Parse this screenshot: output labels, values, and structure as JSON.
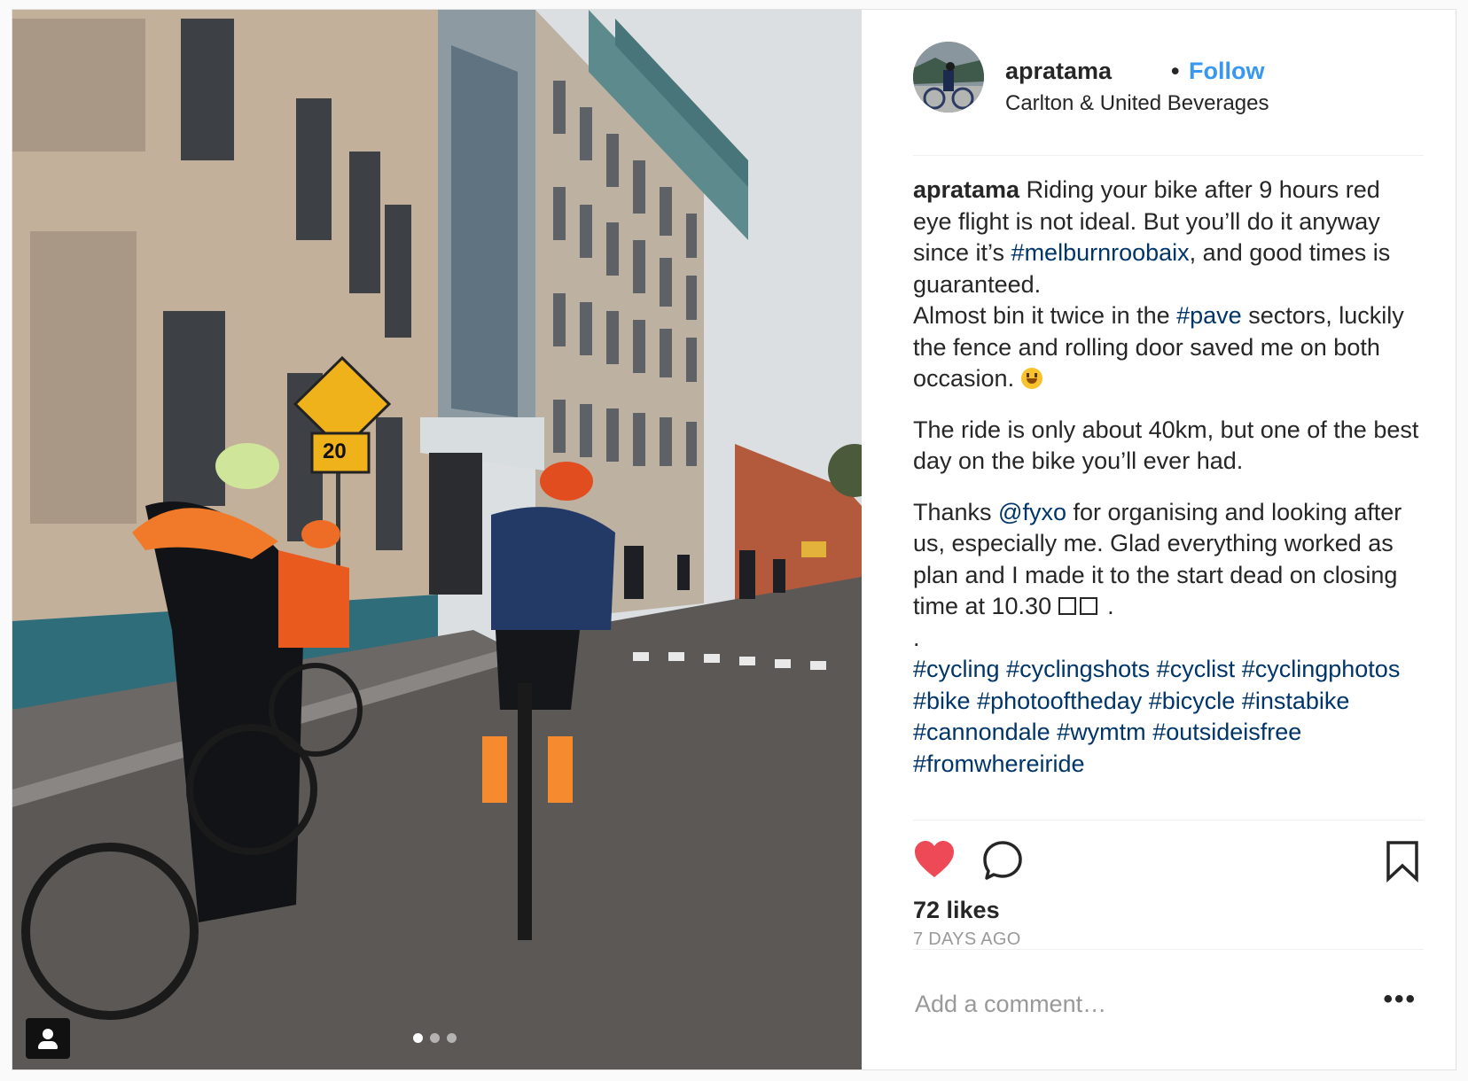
{
  "post": {
    "carousel_dot_count": 3,
    "active_dot": 0
  },
  "header": {
    "username": "apratama",
    "separator": "•",
    "follow_label": "Follow",
    "location": "Carlton & United Beverages"
  },
  "caption": {
    "author": "apratama",
    "p1_text_a": " Riding your bike after 9 hours red eye flight is not ideal. But you’ll do it anyway since it’s ",
    "p1_tag": "#melburnroobaix",
    "p1_text_b": ", and good times is guaranteed.",
    "p2_text_a": "Almost bin it twice in the ",
    "p2_tag": "#pave",
    "p2_text_b": " sectors, luckily the fence and rolling door saved me on both occasion. ",
    "p3_text": "The ride is only about 40km, but one of the best day on the bike you’ll ever had.",
    "p4_text_a": "Thanks ",
    "p4_mention": "@fyxo",
    "p4_text_b": " for organising and looking after us, especially me. Glad everything worked as plan and I made it to the start dead on closing time at 10.30 ",
    "p4_end": ".",
    "dot_line": ".",
    "hashtags": [
      "#cycling",
      "#cyclingshots",
      "#cyclist",
      "#cyclingphotos",
      "#bike",
      "#photooftheday",
      "#bicycle",
      "#instabike",
      "#cannondale",
      "#wymtm",
      "#outsideisfree",
      "#fromwhereiride"
    ]
  },
  "actions": {
    "likes": "72 likes",
    "time_ago": "7 DAYS AGO",
    "like_icon_color": "#ed4956"
  },
  "comment": {
    "placeholder": "Add a comment…",
    "more_label": "•••"
  }
}
